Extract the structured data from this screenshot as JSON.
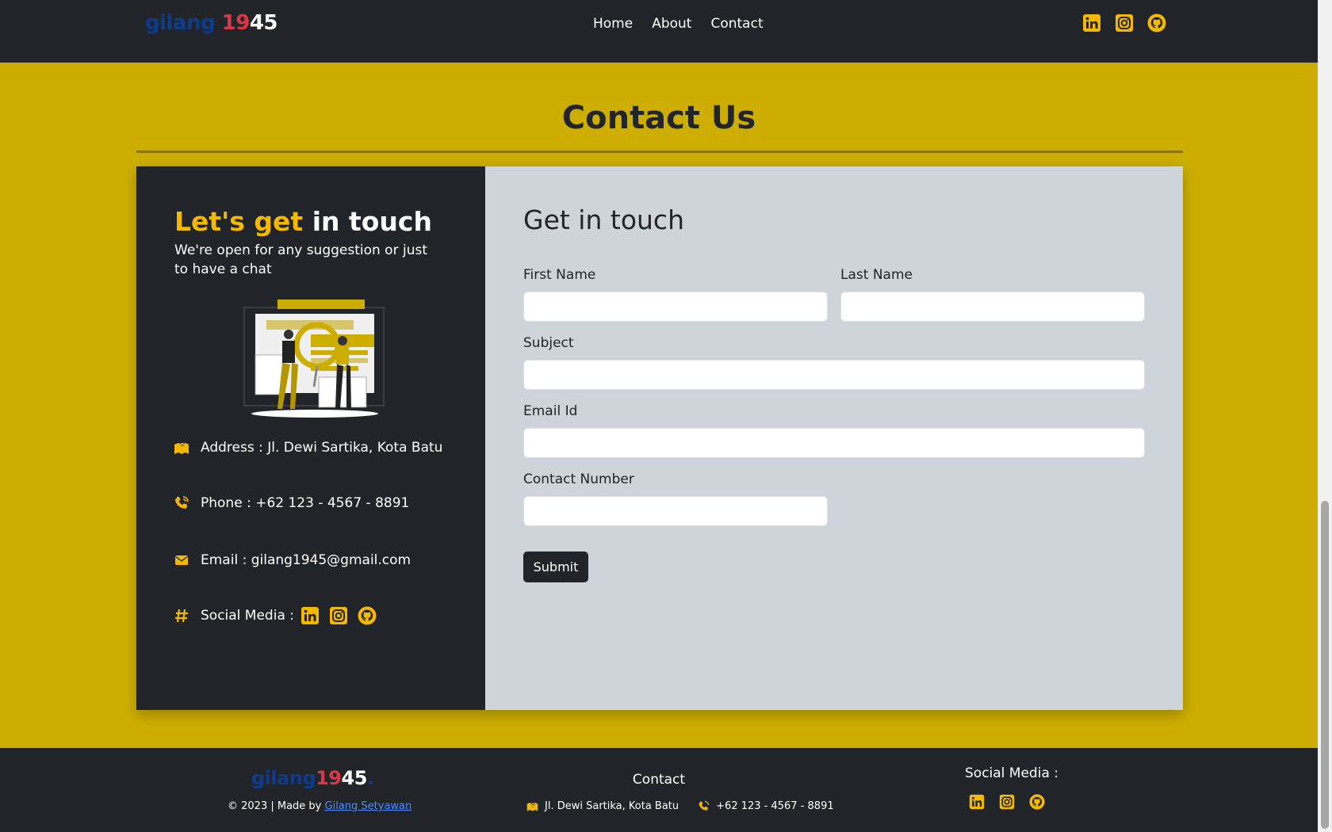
{
  "brand": {
    "part1": "gilang ",
    "part2": "19",
    "part3": "45"
  },
  "nav": {
    "links": [
      "Home",
      "About",
      "Contact"
    ]
  },
  "page_title": "Contact Us",
  "left_panel": {
    "title_highlight": "Let's get",
    "title_rest": " in touch",
    "subtitle": "We're open for any suggestion or just to have a chat",
    "address": "Address : Jl. Dewi Sartika, Kota Batu",
    "phone": "Phone : +62 123 - 4567 - 8891",
    "email": "Email : gilang1945@gmail.com",
    "social_label": "Social Media :"
  },
  "form": {
    "title": "Get in touch",
    "first_name_label": "First Name",
    "last_name_label": "Last Name",
    "subject_label": "Subject",
    "email_label": "Email Id",
    "contact_label": "Contact Number",
    "submit_label": "Submit"
  },
  "footer": {
    "brand_part1": "gilang",
    "brand_part2": "19",
    "brand_part3": "45",
    "brand_dot": ".",
    "copyright": "© 2023 | Made by ",
    "author": "Gilang Setyawan",
    "contact_title": "Contact",
    "address": "Jl. Dewi Sartika, Kota Batu",
    "phone": "+62 123 - 4567 - 8891",
    "social_title": "Social Media :"
  },
  "colors": {
    "accent": "#f5b800",
    "background": "#cdae00",
    "dark": "#212529",
    "form_bg": "#ced4da"
  },
  "icons": [
    "linkedin-icon",
    "instagram-icon",
    "github-icon",
    "map-icon",
    "phone-icon",
    "envelope-icon",
    "hash-icon"
  ]
}
